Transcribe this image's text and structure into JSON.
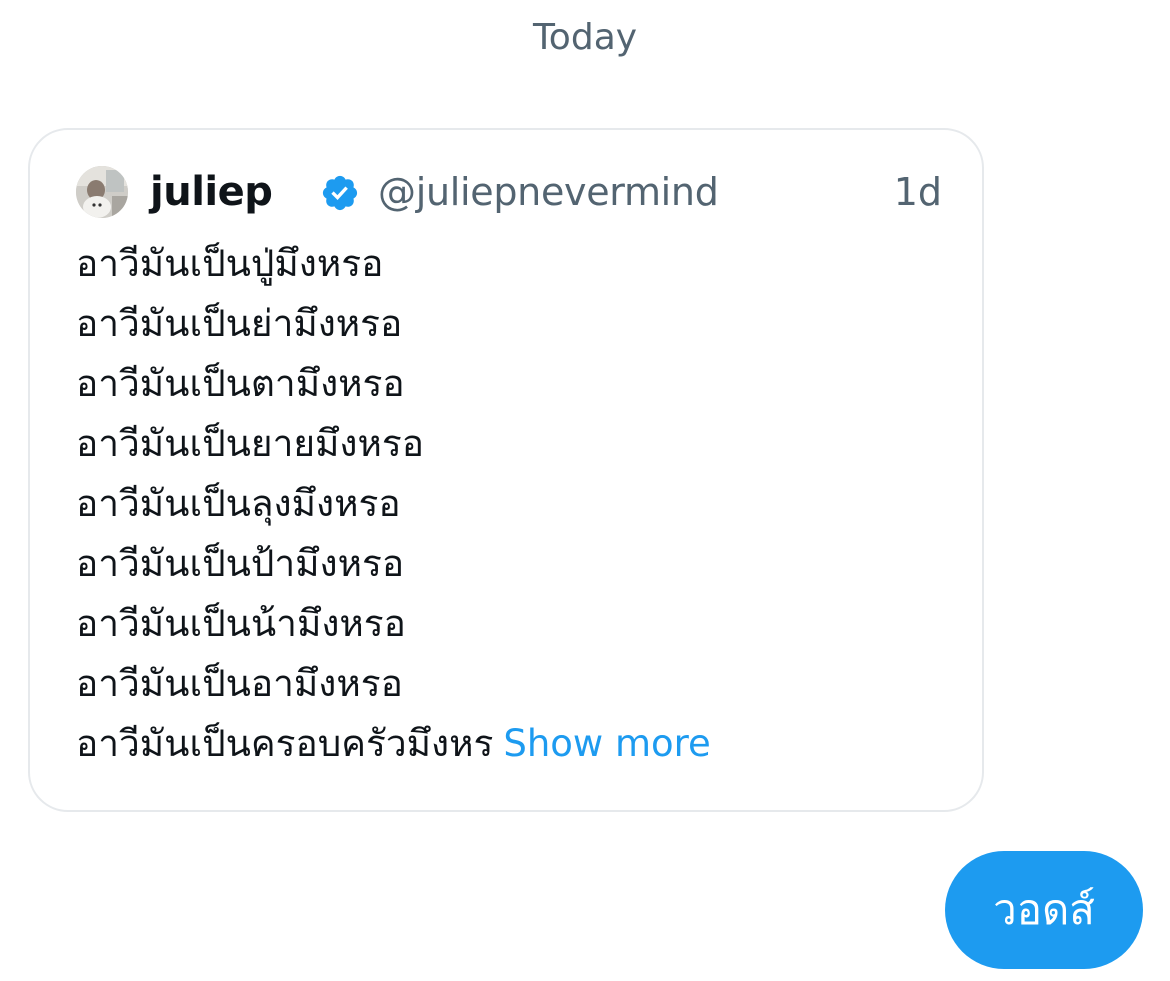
{
  "conversation": {
    "date_divider": "Today"
  },
  "shared_tweet": {
    "author": {
      "name": "juliep",
      "handle": "@juliepnevermind",
      "verified": true
    },
    "time": "1d",
    "lines": [
      "อาวีมันเป็นปู่มึงหรอ",
      "อาวีมันเป็นย่ามึงหรอ",
      "อาวีมันเป็นตามึงหรอ",
      "อาวีมันเป็นยายมึงหรอ",
      "อาวีมันเป็นลุงมึงหรอ",
      "อาวีมันเป็นป้ามึงหรอ",
      "อาวีมันเป็นน้ามึงหรอ",
      "อาวีมันเป็นอามึงหรอ",
      "อาวีมันเป็นครอบครัวมึงหร"
    ],
    "show_more_label": "Show more"
  },
  "sent_message": {
    "text": "วอดส์"
  },
  "colors": {
    "accent": "#1d9bf0",
    "text_primary": "#0f1419",
    "text_secondary": "#536471",
    "card_border": "#e6e9ec"
  },
  "icons": {
    "verified": "verified-badge-icon",
    "avatar": "avatar-image"
  }
}
